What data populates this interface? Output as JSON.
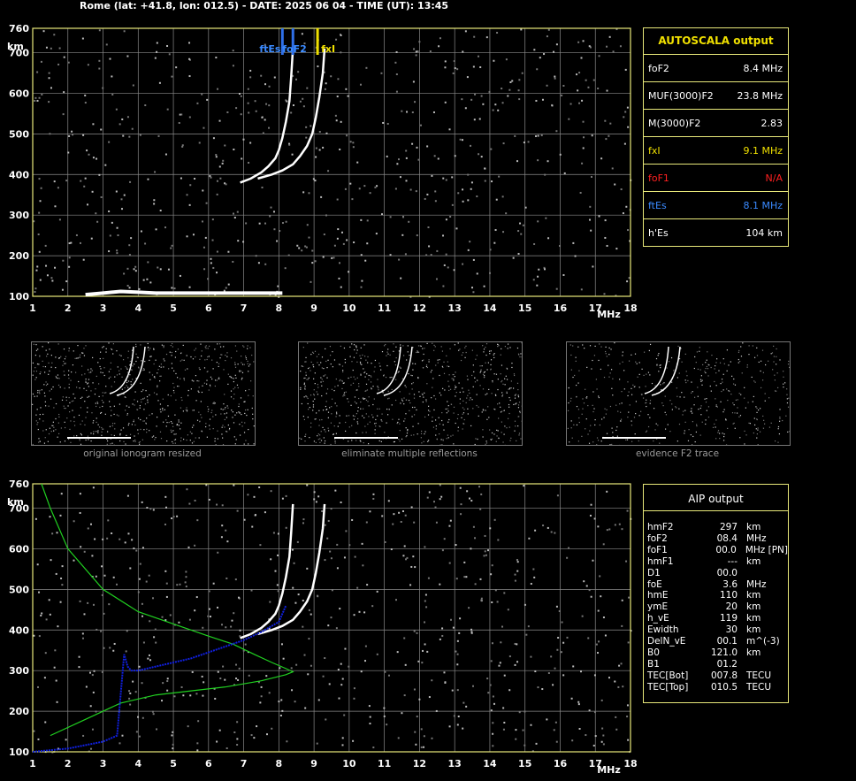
{
  "header": "Rome (lat: +41.8, lon: 012.5) - DATE: 2025 06 04 - TIME (UT): 13:45",
  "colors": {
    "axis": "#e8e87a",
    "grid": "#8a8a8a",
    "trace": "#ffffff",
    "foF2_marker": "#2f6fe8",
    "fxI_marker": "#f0e000",
    "profile": "#20d020",
    "aip_trace": "#1020e0"
  },
  "autoscala": {
    "title": "AUTOSCALA output",
    "rows": [
      {
        "label": "foF2",
        "value": "8.4 MHz",
        "color": "#ffffff"
      },
      {
        "label": "MUF(3000)F2",
        "value": "23.8 MHz",
        "color": "#ffffff"
      },
      {
        "label": "M(3000)F2",
        "value": "2.83",
        "color": "#ffffff"
      },
      {
        "label": "fxI",
        "value": "9.1 MHz",
        "color": "#f0e000"
      },
      {
        "label": "foF1",
        "value": "N/A",
        "color": "#ff2020"
      },
      {
        "label": "ftEs",
        "value": "8.1 MHz",
        "color": "#3a8aff"
      },
      {
        "label": "h'Es",
        "value": "104    km",
        "color": "#ffffff"
      }
    ]
  },
  "aip": {
    "title": "AIP output",
    "rows": [
      {
        "name": "hmF2",
        "value": "297",
        "unit": "km"
      },
      {
        "name": "foF2",
        "value": "08.4",
        "unit": "MHz"
      },
      {
        "name": "foF1",
        "value": "00.0",
        "unit": "MHz    [PN]"
      },
      {
        "name": "hmF1",
        "value": "---",
        "unit": "km"
      },
      {
        "name": "D1",
        "value": "00.0",
        "unit": ""
      },
      {
        "name": "foE",
        "value": "3.6",
        "unit": "MHz"
      },
      {
        "name": "hmE",
        "value": "110",
        "unit": "km"
      },
      {
        "name": "ymE",
        "value": "20",
        "unit": "km"
      },
      {
        "name": "h_vE",
        "value": "119",
        "unit": "km"
      },
      {
        "name": "Ewidth",
        "value": "30",
        "unit": "km"
      },
      {
        "name": "DelN_vE",
        "value": "00.1",
        "unit": "m^(-3)"
      },
      {
        "name": "B0",
        "value": "121.0",
        "unit": "km"
      },
      {
        "name": "B1",
        "value": "01.2",
        "unit": ""
      },
      {
        "name": "TEC[Bot]",
        "value": "007.8",
        "unit": "TECU"
      },
      {
        "name": "TEC[Top]",
        "value": "010.5",
        "unit": "TECU"
      }
    ]
  },
  "thumbnails": [
    {
      "caption": "original ionogram resized"
    },
    {
      "caption": "eliminate multiple reflections"
    },
    {
      "caption": "evidence F2 trace"
    }
  ],
  "chart_data": [
    {
      "type": "scatter",
      "title": "",
      "xlabel": "MHz",
      "ylabel": "km",
      "xlim": [
        1,
        18
      ],
      "ylim": [
        100,
        760
      ],
      "x_ticks": [
        1,
        2,
        3,
        4,
        5,
        6,
        7,
        8,
        9,
        10,
        11,
        12,
        13,
        14,
        15,
        16,
        17,
        18
      ],
      "y_ticks": [
        100,
        200,
        300,
        400,
        500,
        600,
        700,
        760
      ],
      "markers": [
        {
          "label": "ftEs",
          "x": 8.1,
          "color": "#2f6fe8"
        },
        {
          "label": "foF2",
          "x": 8.4,
          "color": "#2f6fe8"
        },
        {
          "label": "fxI",
          "x": 9.1,
          "color": "#f0e000"
        }
      ],
      "series": [
        {
          "name": "O trace",
          "x": [
            6.9,
            7.2,
            7.5,
            7.7,
            7.9,
            8.0,
            8.1,
            8.2,
            8.3,
            8.35,
            8.4
          ],
          "y": [
            380,
            390,
            405,
            420,
            440,
            460,
            490,
            530,
            580,
            640,
            710
          ]
        },
        {
          "name": "X trace",
          "x": [
            7.4,
            7.8,
            8.1,
            8.4,
            8.6,
            8.8,
            8.95,
            9.05,
            9.15,
            9.25,
            9.3
          ],
          "y": [
            390,
            400,
            410,
            425,
            445,
            470,
            500,
            540,
            590,
            650,
            710
          ]
        },
        {
          "name": "Es trace",
          "x": [
            2.5,
            3.0,
            3.5,
            4.0,
            4.5,
            5.0,
            5.5,
            6.0,
            6.5,
            7.0,
            7.5,
            8.1
          ],
          "y": [
            104,
            108,
            112,
            110,
            108,
            108,
            108,
            108,
            108,
            108,
            108,
            108
          ]
        }
      ]
    },
    {
      "type": "line",
      "title": "",
      "xlabel": "MHz",
      "ylabel": "km",
      "xlim": [
        1,
        18
      ],
      "ylim": [
        100,
        760
      ],
      "x_ticks": [
        1,
        2,
        3,
        4,
        5,
        6,
        7,
        8,
        9,
        10,
        11,
        12,
        13,
        14,
        15,
        16,
        17,
        18
      ],
      "y_ticks": [
        100,
        200,
        300,
        400,
        500,
        600,
        700,
        760
      ],
      "series": [
        {
          "name": "O trace",
          "x": [
            6.9,
            7.2,
            7.5,
            7.7,
            7.9,
            8.0,
            8.1,
            8.2,
            8.3,
            8.35,
            8.4
          ],
          "y": [
            380,
            390,
            405,
            420,
            440,
            460,
            490,
            530,
            580,
            640,
            710
          ]
        },
        {
          "name": "X trace",
          "x": [
            7.4,
            7.8,
            8.1,
            8.4,
            8.6,
            8.8,
            8.95,
            9.05,
            9.15,
            9.25,
            9.3
          ],
          "y": [
            390,
            400,
            410,
            425,
            445,
            470,
            500,
            540,
            590,
            650,
            710
          ]
        },
        {
          "name": "",
          "x": [
            1.25,
            1.5,
            2.0,
            3.0,
            4.0,
            5.0,
            6.0,
            6.7,
            7.3,
            7.8,
            8.2,
            8.4,
            8.2,
            7.5,
            6.5,
            5.5,
            4.5,
            3.5,
            2.5,
            1.5
          ],
          "y": [
            760,
            700,
            600,
            500,
            445,
            415,
            385,
            365,
            340,
            320,
            305,
            297,
            290,
            275,
            260,
            250,
            240,
            220,
            180,
            140
          ]
        },
        {
          "name": "",
          "x": [
            1.0,
            2.0,
            3.0,
            3.4,
            3.6,
            3.7,
            3.8,
            4.0,
            4.5,
            5.0,
            5.5,
            6.0,
            6.5,
            7.0,
            7.5,
            8.0,
            8.2
          ],
          "y": [
            100,
            108,
            125,
            140,
            340,
            310,
            300,
            300,
            310,
            320,
            330,
            345,
            360,
            375,
            395,
            420,
            460
          ]
        }
      ]
    }
  ]
}
